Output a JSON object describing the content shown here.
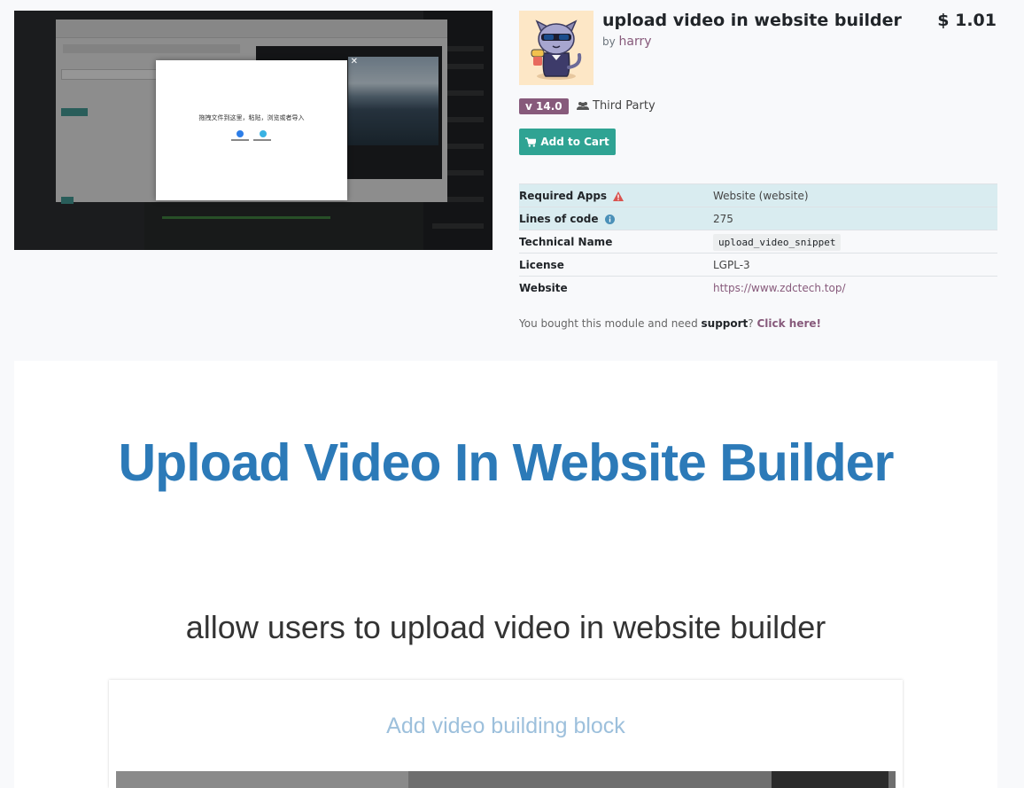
{
  "product": {
    "title": "upload video in website builder",
    "by_prefix": "by",
    "author": "harry",
    "price": "$ 1.01",
    "version": "v 14.0",
    "third_party": "Third Party",
    "add_to_cart": "Add to Cart"
  },
  "info_table": {
    "required_apps_label": "Required Apps",
    "required_apps_value": "Website (website)",
    "lines_of_code_label": "Lines of code",
    "lines_of_code_value": "275",
    "technical_name_label": "Technical Name",
    "technical_name_value": "upload_video_snippet",
    "license_label": "License",
    "license_value": "LGPL-3",
    "website_label": "Website",
    "website_value": "https://www.zdctech.top/"
  },
  "support": {
    "prefix": "You bought this module and need",
    "strong": "support",
    "q": "?",
    "link": "Click here!"
  },
  "screenshot": {
    "modal_text": "拖拽文件到这里，粘贴，浏览或者导入"
  },
  "description": {
    "heading": "Upload Video In Website Builder",
    "subtitle": "allow users to upload video in website builder",
    "card_title": "Add video building block"
  },
  "colors": {
    "accent": "#875a7b",
    "cart_button": "#2fa393",
    "heading": "#2c7ab8",
    "highlight_row": "#d9ecf0"
  },
  "icons": [
    "cat-mascot-icon",
    "users-icon",
    "shopping-cart-icon",
    "warning-icon",
    "info-icon",
    "close-icon"
  ]
}
